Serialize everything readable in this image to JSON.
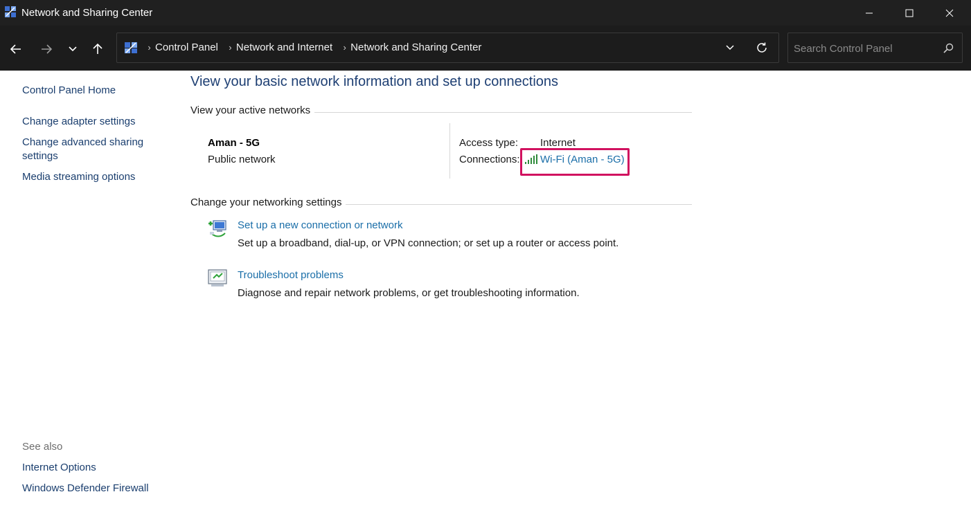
{
  "window": {
    "title": "Network and Sharing Center",
    "icons": {
      "app": "network-center-icon",
      "minimize": "minimize-icon",
      "maximize": "maximize-icon",
      "close": "close-icon"
    }
  },
  "nav": {
    "icons": [
      "back-arrow-icon",
      "forward-arrow-icon",
      "chevron-down-icon",
      "up-arrow-icon"
    ],
    "breadcrumbs": [
      "Control Panel",
      "Network and Internet",
      "Network and Sharing Center"
    ],
    "search": {
      "placeholder": "Search Control Panel",
      "value": ""
    }
  },
  "sidebar": {
    "home": "Control Panel Home",
    "links": [
      "Change adapter settings",
      "Change advanced sharing settings",
      "Media streaming options"
    ],
    "see_also_label": "See also",
    "see_also": [
      "Internet Options",
      "Windows Defender Firewall"
    ]
  },
  "main": {
    "title": "View your basic network information and set up connections",
    "active_networks": {
      "heading": "View your active networks",
      "network_name": "Aman - 5G",
      "network_type": "Public network",
      "access_type_label": "Access type:",
      "access_type_value": "Internet",
      "connections_label": "Connections:",
      "connection_link": "Wi-Fi (Aman - 5G)",
      "highlight_color": "#d1125f"
    },
    "settings": {
      "heading": "Change your networking settings",
      "tasks": [
        {
          "link": "Set up a new connection or network",
          "desc": "Set up a broadband, dial-up, or VPN connection; or set up a router or access point.",
          "icon": "new-connection-icon"
        },
        {
          "link": "Troubleshoot problems",
          "desc": "Diagnose and repair network problems, or get troubleshooting information.",
          "icon": "troubleshoot-icon"
        }
      ]
    }
  },
  "colors": {
    "link": "#1a6ea8",
    "title": "#1e3f73",
    "titlebar": "#202020",
    "navbar": "#1c1c1c"
  }
}
